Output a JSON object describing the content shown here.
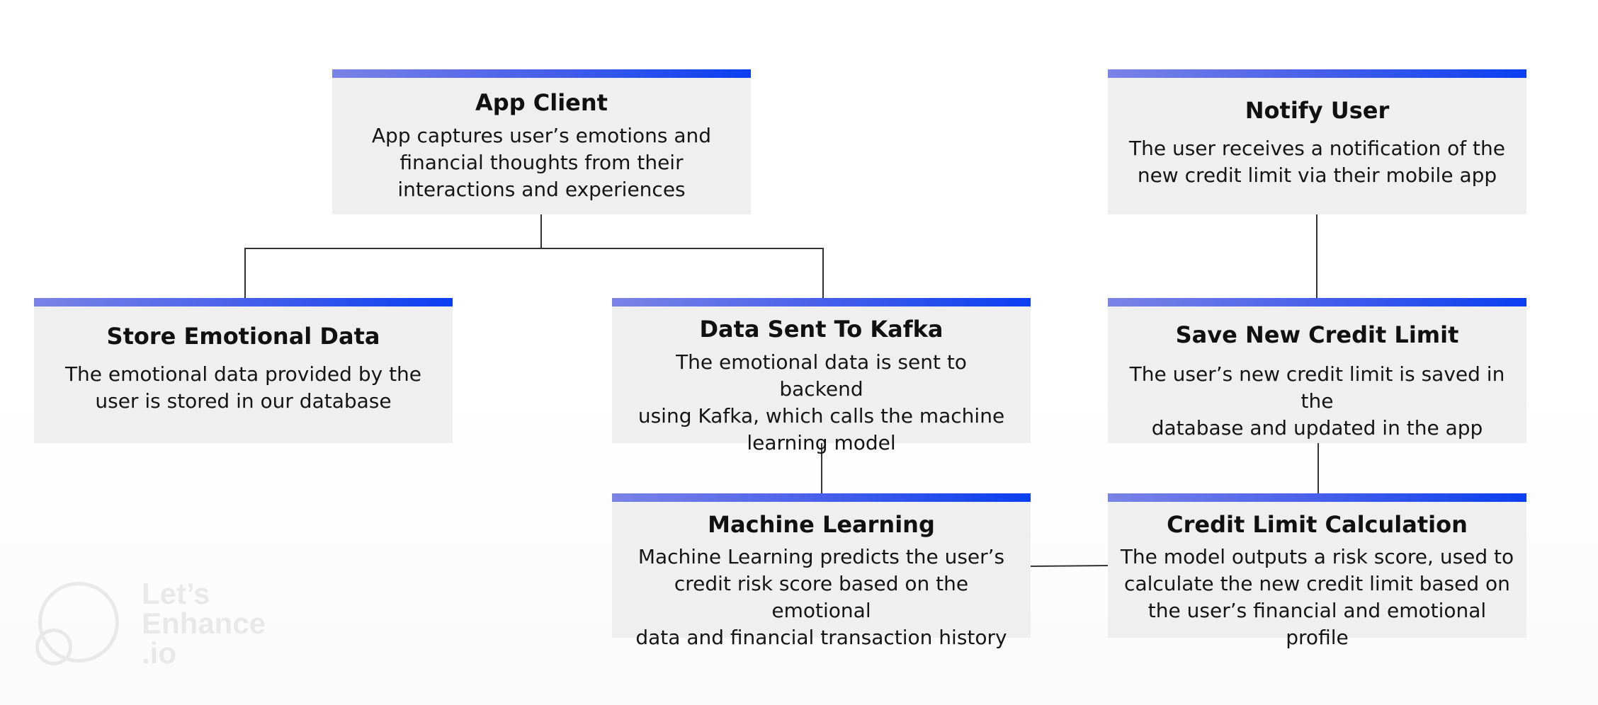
{
  "colors": {
    "box_fill": "#efefef",
    "accent_bar_start": "#7a83e6",
    "accent_bar_end": "#0a3ff0",
    "connector": "#333333",
    "text": "#111111"
  },
  "nodes": {
    "app_client": {
      "title": "App Client",
      "lines": [
        "App captures user’s emotions and",
        "financial thoughts from their",
        "interactions and experiences"
      ]
    },
    "notify_user": {
      "title": "Notify User",
      "lines": [
        "The user receives a notification of the",
        "new credit limit via their mobile app"
      ]
    },
    "store_emotional_data": {
      "title": "Store Emotional Data",
      "lines": [
        "The emotional data provided by the",
        "user is stored in our database"
      ]
    },
    "data_sent_kafka": {
      "title": "Data Sent To Kafka",
      "lines": [
        "The emotional data is sent to backend",
        "using Kafka, which calls the machine",
        "learning model"
      ]
    },
    "save_credit_limit": {
      "title": "Save New Credit Limit",
      "lines": [
        "The user’s new credit limit is saved in the",
        "database and updated in the app"
      ]
    },
    "machine_learning": {
      "title": "Machine Learning",
      "lines": [
        "Machine Learning predicts the user’s",
        "credit risk score based on the emotional",
        "data and financial transaction history"
      ]
    },
    "credit_limit_calculation": {
      "title": "Credit Limit Calculation",
      "lines": [
        "The model outputs a risk score, used to",
        "calculate the new credit limit based on",
        "the user’s financial and emotional profile"
      ]
    }
  },
  "edges": [
    {
      "from": "App Client",
      "to": "Store Emotional Data"
    },
    {
      "from": "App Client",
      "to": "Data Sent To Kafka"
    },
    {
      "from": "Data Sent To Kafka",
      "to": "Machine Learning"
    },
    {
      "from": "Machine Learning",
      "to": "Credit Limit Calculation"
    },
    {
      "from": "Credit Limit Calculation",
      "to": "Save New Credit Limit"
    },
    {
      "from": "Save New Credit Limit",
      "to": "Notify User"
    }
  ],
  "watermark": {
    "lines": [
      "Let’s",
      "Enhance",
      ".io"
    ]
  }
}
